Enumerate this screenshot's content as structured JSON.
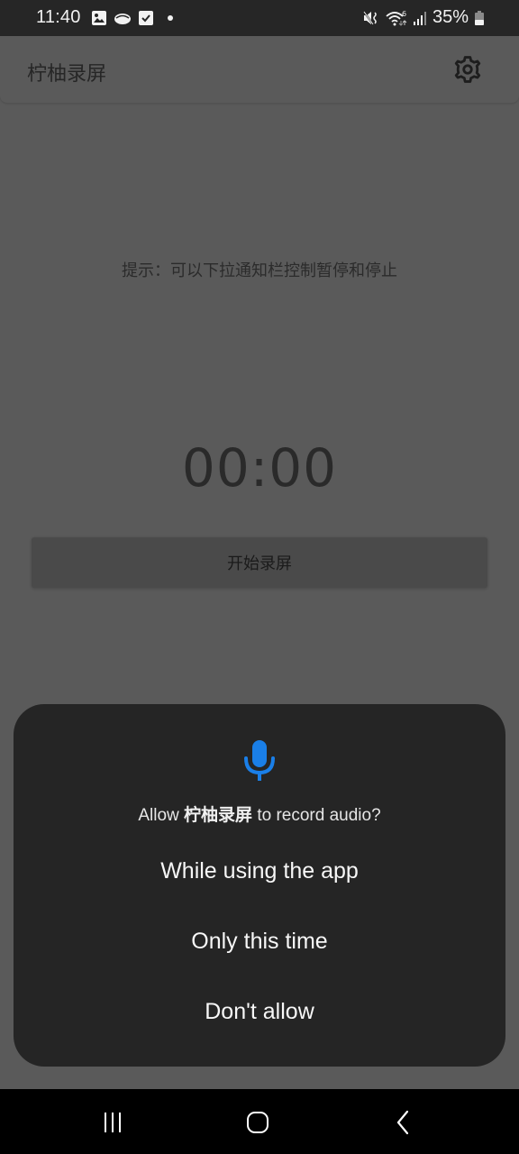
{
  "status_bar": {
    "time": "11:40",
    "notification_icons": [
      "gallery-icon",
      "cloud-app-icon",
      "checkbox-app-icon",
      "dot-indicator"
    ],
    "system_icons": [
      "mute-vibrate-icon",
      "wifi-6-icon",
      "signal-icon",
      "battery-icon"
    ],
    "battery_percent": "35%"
  },
  "app_bar": {
    "title": "柠柚录屏",
    "settings_icon": "gear-icon"
  },
  "main": {
    "hint": "提示：可以下拉通知栏控制暂停和停止",
    "timer": "00:00",
    "start_button_label": "开始录屏"
  },
  "dialog": {
    "icon": "microphone-icon",
    "icon_color": "#1a7fe8",
    "message_prefix": "Allow ",
    "message_app_name": "柠柚录屏",
    "message_suffix": " to record audio?",
    "options": [
      {
        "label": "While using the app"
      },
      {
        "label": "Only this time"
      },
      {
        "label": "Don't allow"
      }
    ]
  },
  "nav_bar": {
    "buttons": [
      "recents-icon",
      "home-icon",
      "back-icon"
    ]
  }
}
